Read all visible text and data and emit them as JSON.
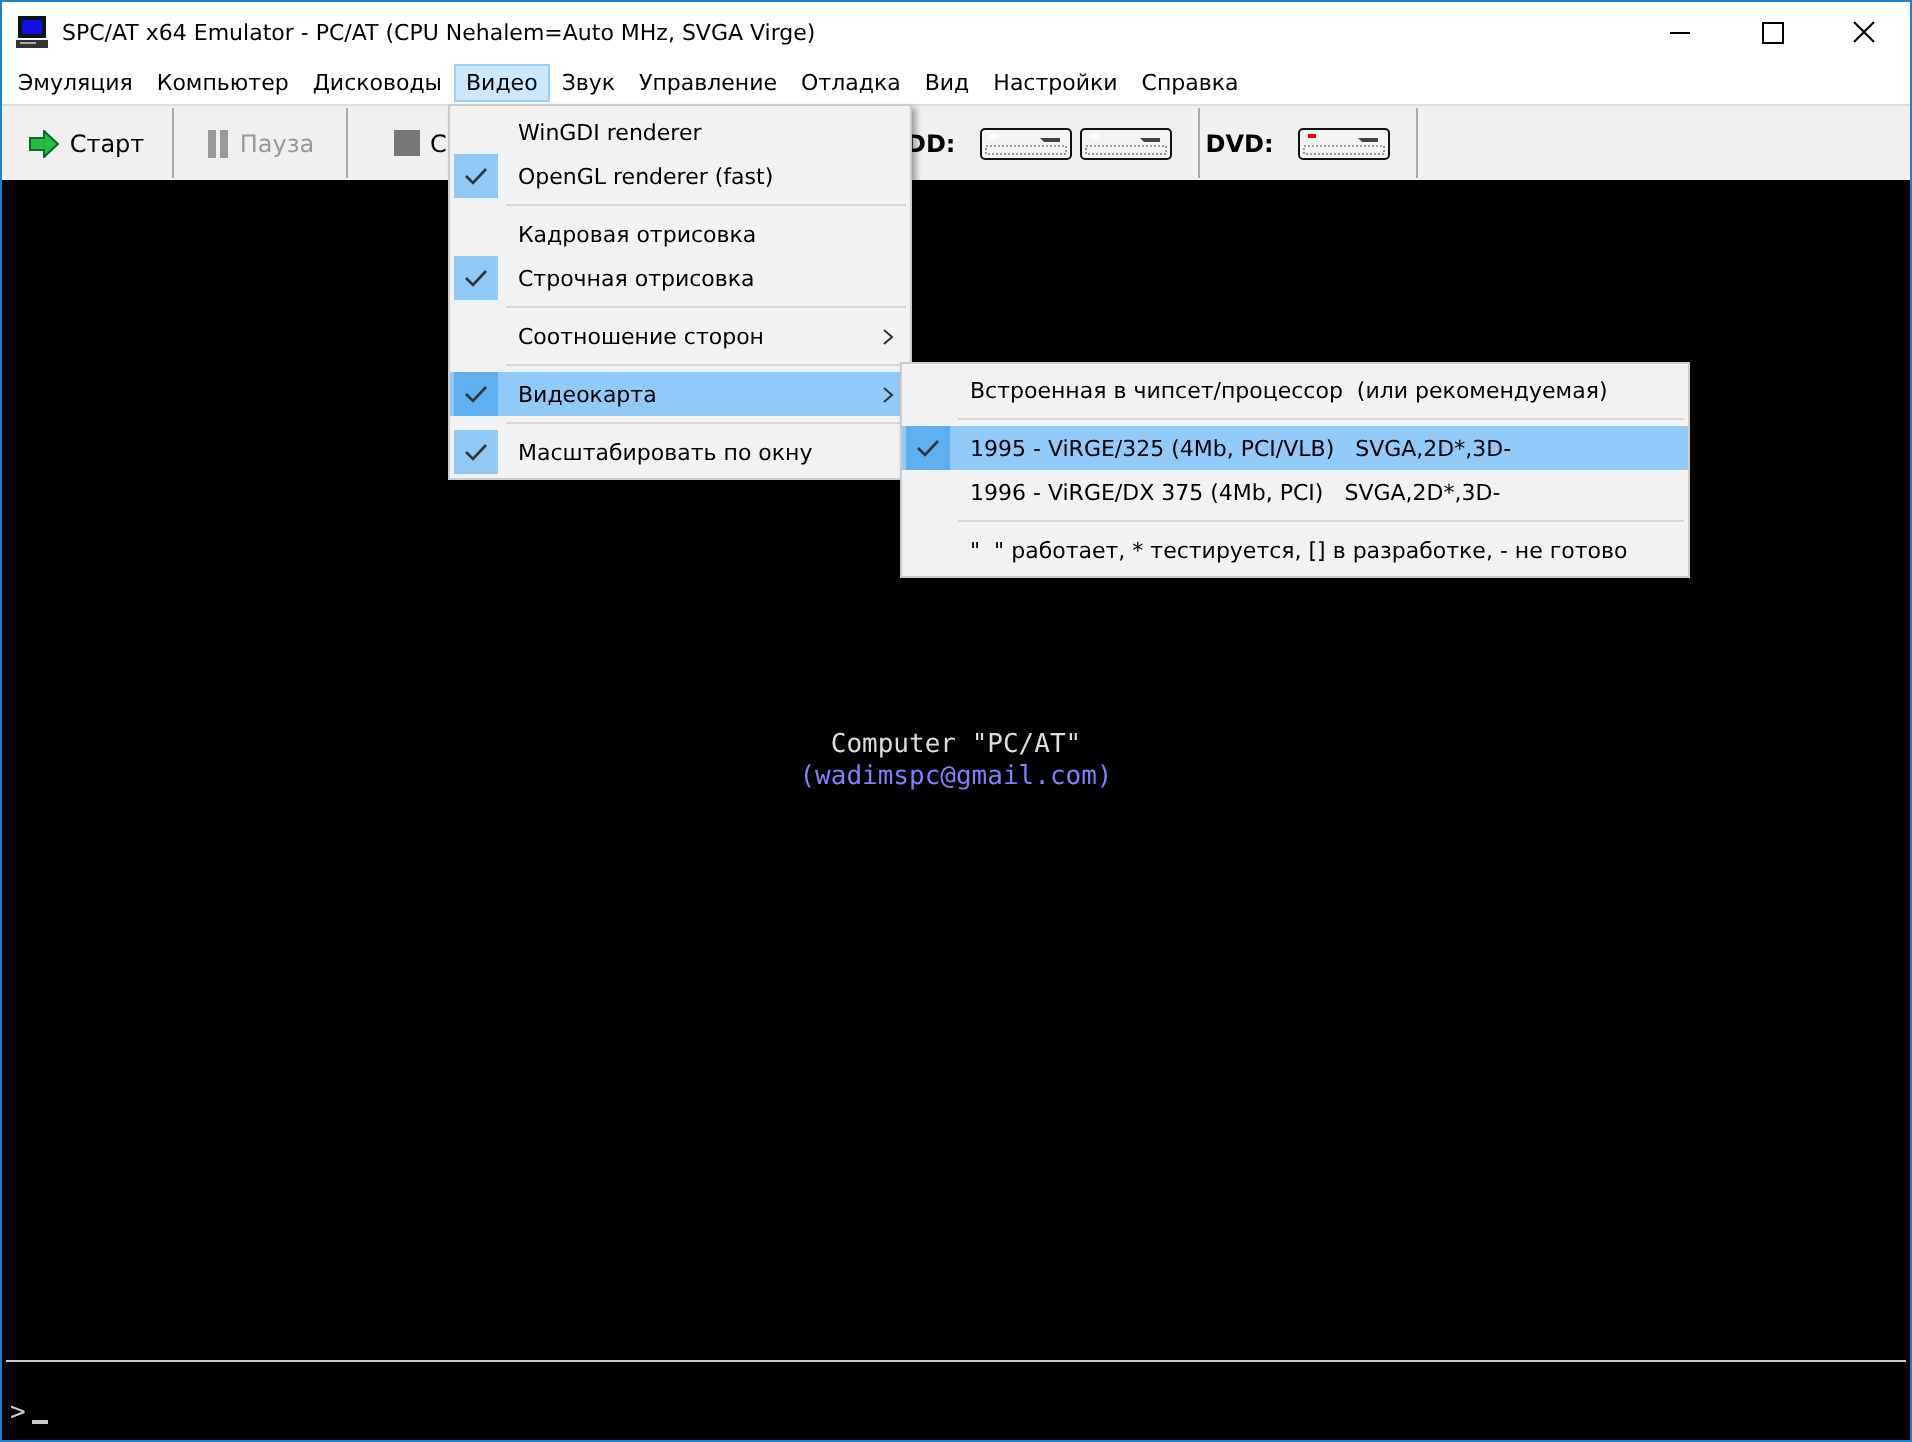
{
  "window": {
    "title": "SPC/AT x64 Emulator - PC/AT (CPU Nehalem=Auto MHz, SVGA Virge)"
  },
  "menubar": [
    {
      "label": "Эмуляция",
      "selected": false
    },
    {
      "label": "Компьютер",
      "selected": false
    },
    {
      "label": "Дисководы",
      "selected": false
    },
    {
      "label": "Видео",
      "selected": true
    },
    {
      "label": "Звук",
      "selected": false
    },
    {
      "label": "Управление",
      "selected": false
    },
    {
      "label": "Отладка",
      "selected": false
    },
    {
      "label": "Вид",
      "selected": false
    },
    {
      "label": "Настройки",
      "selected": false
    },
    {
      "label": "Справка",
      "selected": false
    }
  ],
  "toolbar": {
    "buttons": [
      {
        "label": "Старт",
        "kind": "start",
        "disabled": false
      },
      {
        "label": "Пауза",
        "kind": "pause",
        "disabled": true
      },
      {
        "label": "С",
        "kind": "stop",
        "disabled": false
      }
    ],
    "drive_groups": [
      {
        "label": "DD:",
        "drives": [
          {
            "color": "#ffffff"
          },
          {
            "color": "#ffffff"
          }
        ]
      },
      {
        "label": "DVD:",
        "drives": [
          {
            "color": "#ff0000"
          }
        ]
      }
    ]
  },
  "video_menu": [
    {
      "kind": "item",
      "label": "WinGDI renderer",
      "checked": false,
      "selected": false,
      "submenu": false
    },
    {
      "kind": "item",
      "label": "OpenGL renderer (fast)",
      "checked": true,
      "selected": false,
      "submenu": false
    },
    {
      "kind": "separator"
    },
    {
      "kind": "item",
      "label": "Кадровая отрисовка",
      "checked": false,
      "selected": false,
      "submenu": false
    },
    {
      "kind": "item",
      "label": "Строчная отрисовка",
      "checked": true,
      "selected": false,
      "submenu": false
    },
    {
      "kind": "separator"
    },
    {
      "kind": "item",
      "label": "Соотношение сторон",
      "checked": false,
      "selected": false,
      "submenu": true
    },
    {
      "kind": "separator"
    },
    {
      "kind": "item",
      "label": "Видеокарта",
      "checked": true,
      "selected": true,
      "submenu": true
    },
    {
      "kind": "separator"
    },
    {
      "kind": "item",
      "label": "Масштабировать по окну",
      "checked": true,
      "selected": false,
      "submenu": false
    }
  ],
  "videocard_submenu": [
    {
      "kind": "item",
      "label": "Встроенная в чипсет/процессор  (или рекомендуемая)",
      "checked": false,
      "selected": false,
      "submenu": false
    },
    {
      "kind": "separator"
    },
    {
      "kind": "item",
      "label": "1995 - ViRGE/325 (4Mb, PCI/VLB)   SVGA,2D*,3D-",
      "checked": true,
      "selected": true,
      "submenu": false
    },
    {
      "kind": "item",
      "label": "1996 - ViRGE/DX 375 (4Mb, PCI)   SVGA,2D*,3D-",
      "checked": false,
      "selected": false,
      "submenu": false
    },
    {
      "kind": "separator"
    },
    {
      "kind": "item",
      "label": "\"  \" работает, * тестируется, [] в разработке, - не готово",
      "checked": false,
      "selected": false,
      "submenu": false
    }
  ],
  "screen": {
    "lines": [
      "Computer \"PC/AT\"",
      "(wadimspc@gmail.com)"
    ],
    "prompt": ">"
  }
}
